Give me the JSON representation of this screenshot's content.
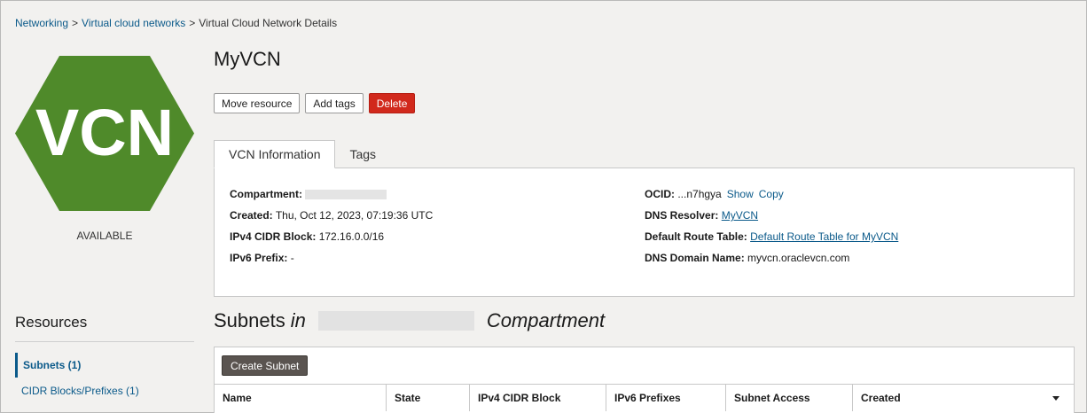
{
  "breadcrumb": {
    "items": [
      "Networking",
      "Virtual cloud networks",
      "Virtual Cloud Network Details"
    ]
  },
  "resource": {
    "icon_text": "VCN",
    "icon_color": "#4f8a2a",
    "status": "AVAILABLE",
    "title": "MyVCN"
  },
  "actions": {
    "move": "Move resource",
    "tags": "Add tags",
    "delete": "Delete"
  },
  "tabs": [
    {
      "label": "VCN Information",
      "active": true
    },
    {
      "label": "Tags",
      "active": false
    }
  ],
  "info": {
    "compartment_label": "Compartment:",
    "created_label": "Created:",
    "created_value": "Thu, Oct 12, 2023, 07:19:36 UTC",
    "ipv4_label": "IPv4 CIDR Block:",
    "ipv4_value": "172.16.0.0/16",
    "ipv6_label": "IPv6 Prefix:",
    "ipv6_value": "-",
    "ocid_label": "OCID:",
    "ocid_value": "...n7hgya",
    "ocid_show": "Show",
    "ocid_copy": "Copy",
    "dns_resolver_label": "DNS Resolver:",
    "dns_resolver_value": "MyVCN",
    "route_table_label": "Default Route Table:",
    "route_table_value": "Default Route Table for MyVCN",
    "dns_domain_label": "DNS Domain Name:",
    "dns_domain_value": "myvcn.oraclevcn.com"
  },
  "resources": {
    "title": "Resources",
    "items": [
      "Subnets (1)",
      "CIDR Blocks/Prefixes (1)"
    ]
  },
  "subnets": {
    "title": "Subnets",
    "in_word": "in",
    "compartment_word": "Compartment",
    "create_button": "Create Subnet",
    "columns": [
      "Name",
      "State",
      "IPv4 CIDR Block",
      "IPv6 Prefixes",
      "Subnet Access",
      "Created"
    ]
  }
}
